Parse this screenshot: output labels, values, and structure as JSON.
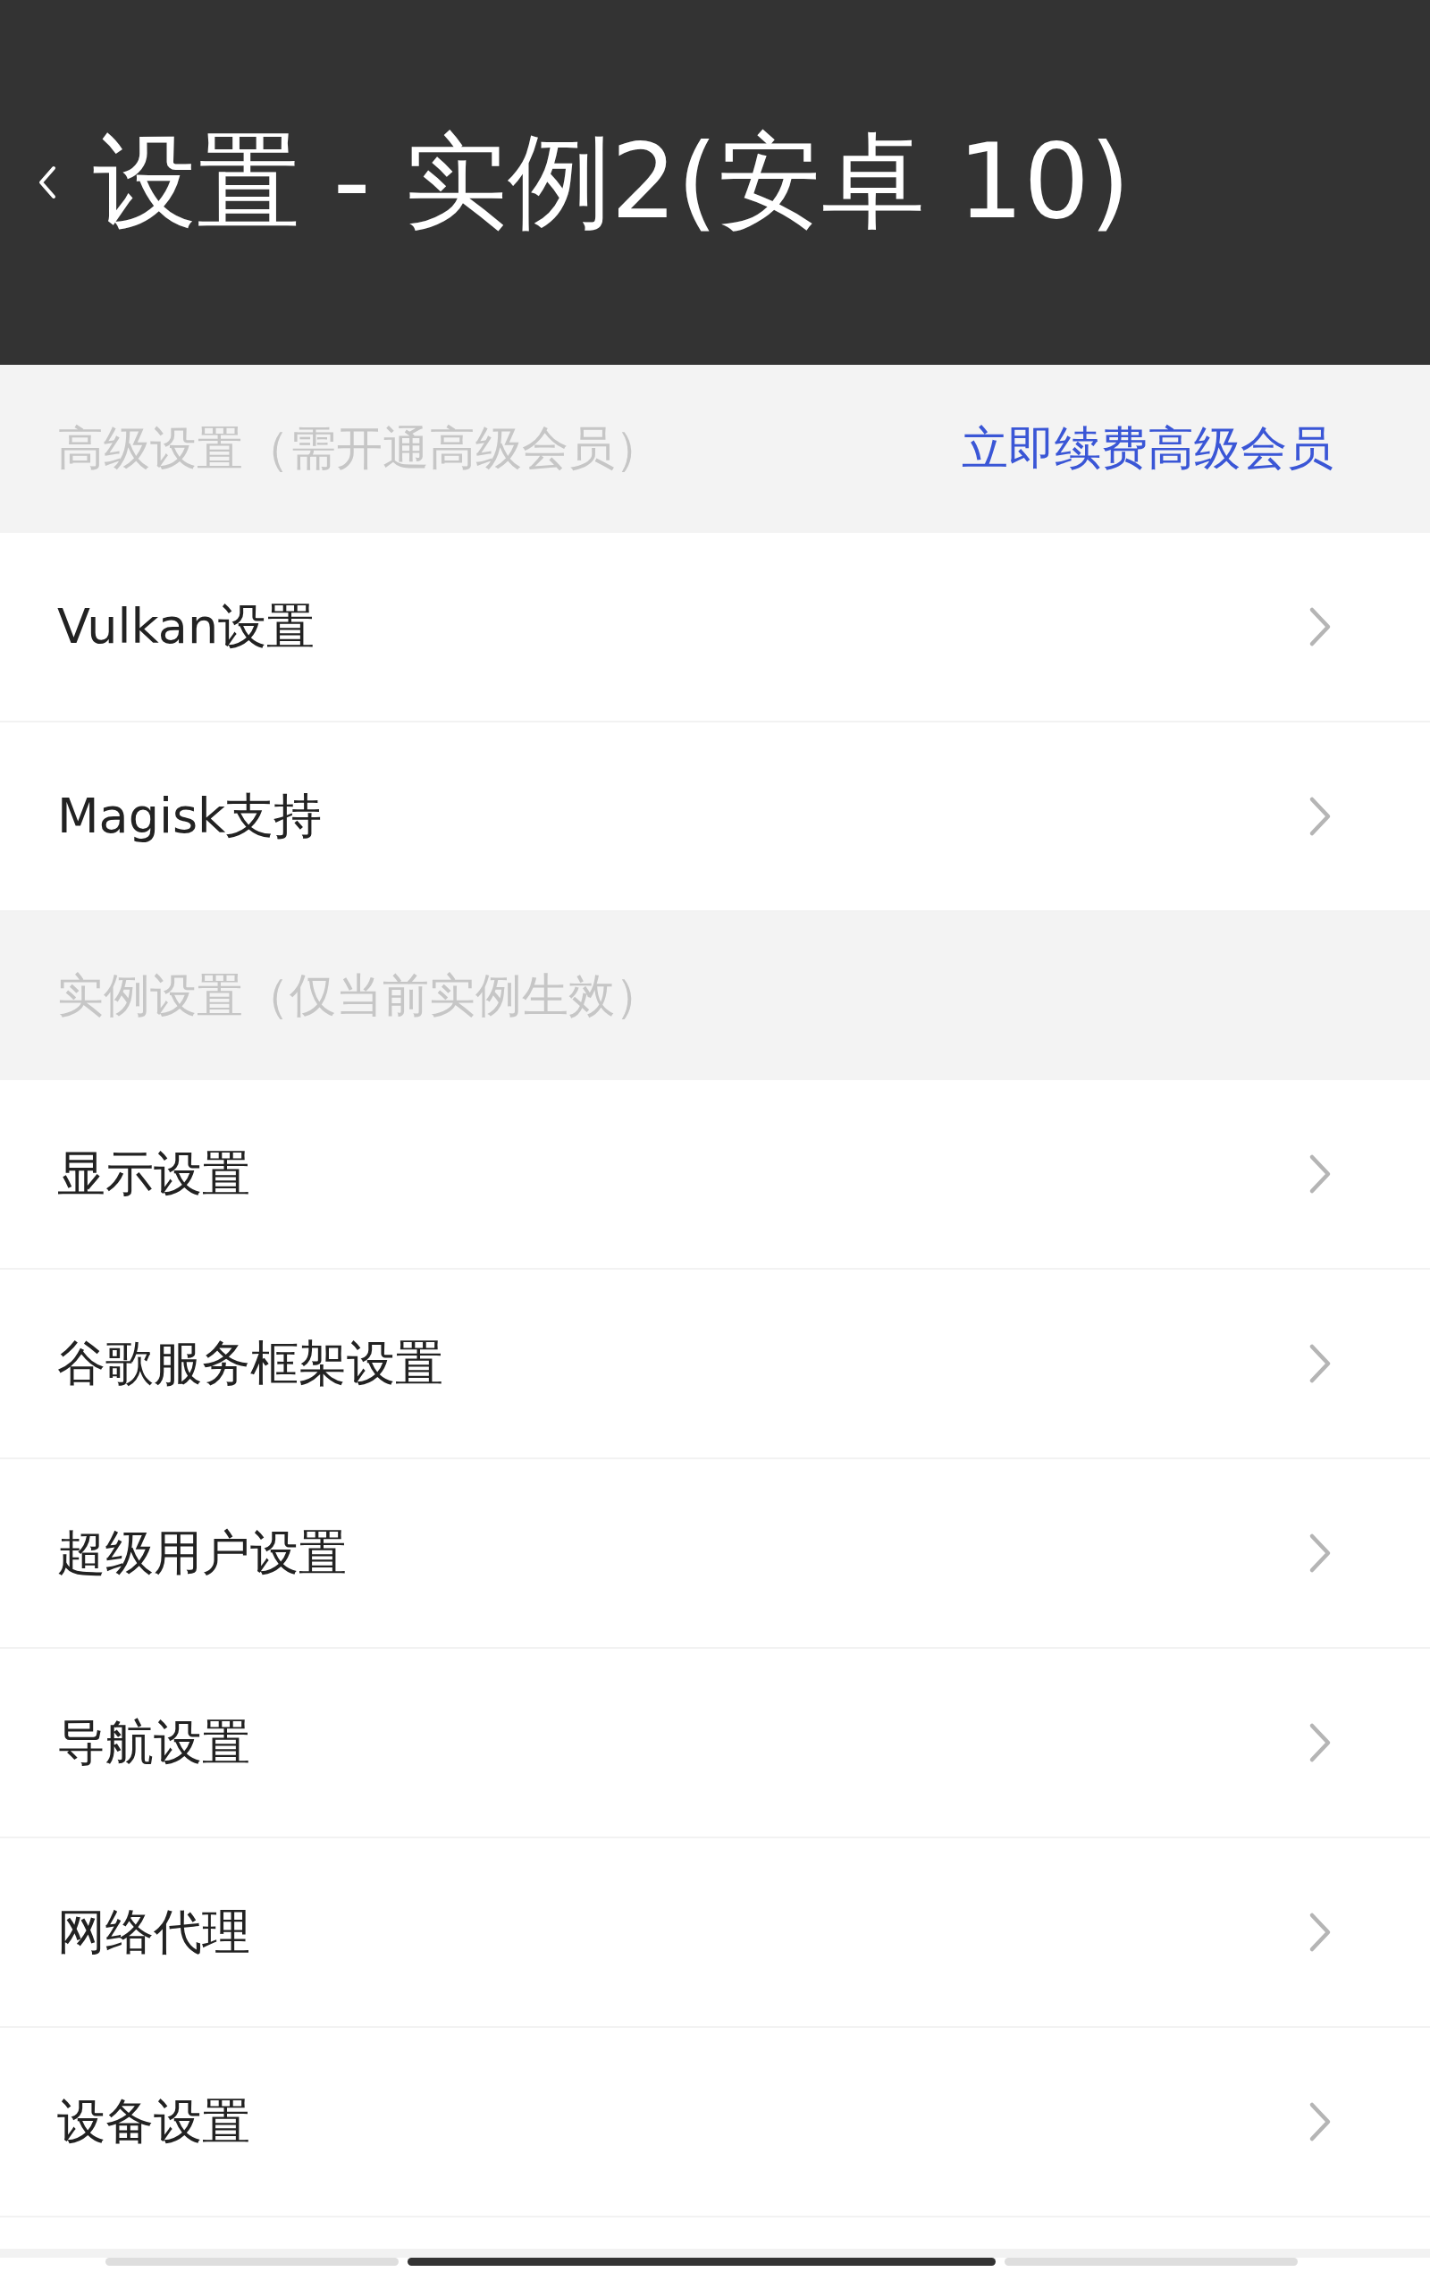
{
  "header": {
    "title": "设置 - 实例2(安卓 10)"
  },
  "sections": [
    {
      "title": "高级设置（需开通高级会员）",
      "link": "立即续费高级会员",
      "items": [
        {
          "label": "Vulkan设置"
        },
        {
          "label": "Magisk支持"
        }
      ]
    },
    {
      "title": "实例设置（仅当前实例生效）",
      "items": [
        {
          "label": "显示设置"
        },
        {
          "label": "谷歌服务框架设置"
        },
        {
          "label": "超级用户设置"
        },
        {
          "label": "导航设置"
        },
        {
          "label": "网络代理"
        },
        {
          "label": "设备设置"
        }
      ]
    }
  ]
}
